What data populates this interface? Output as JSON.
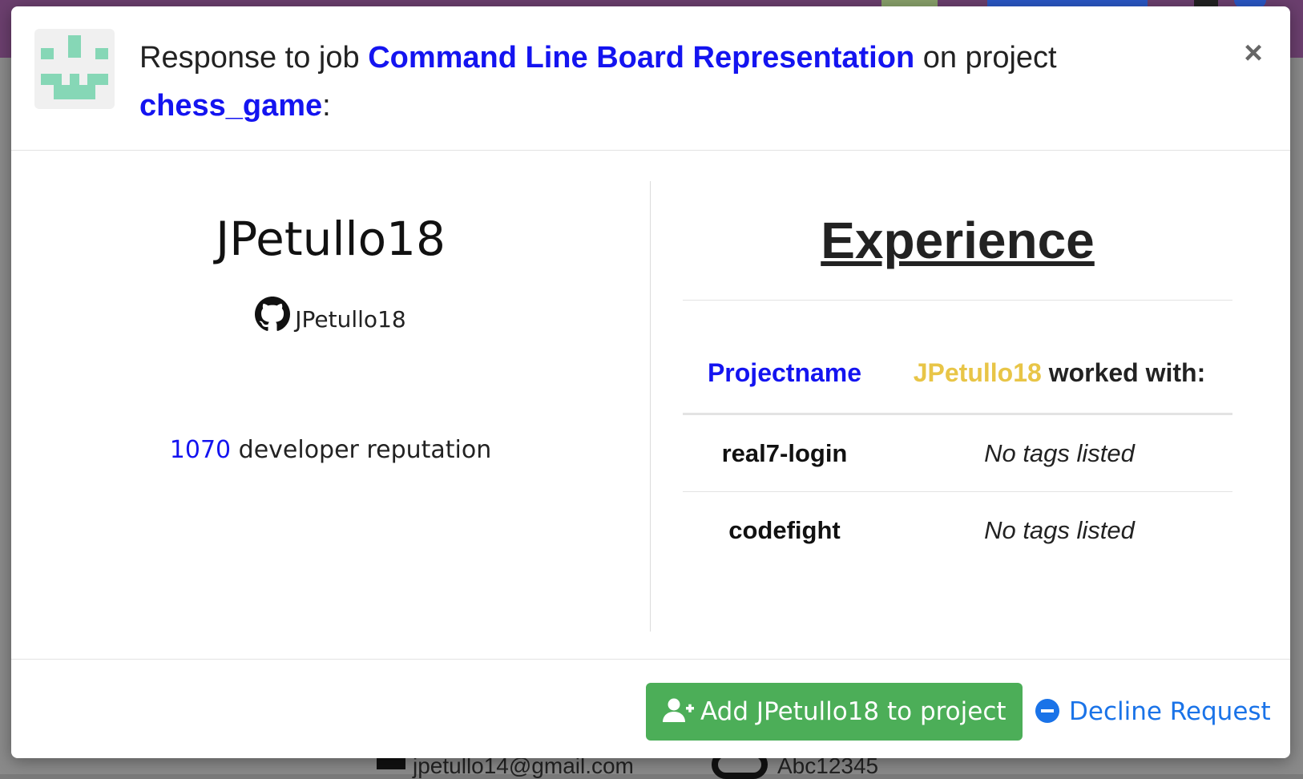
{
  "header": {
    "prefix": "Response to job ",
    "job_name": "Command Line Board Representation",
    "middle": " on project",
    "project_name": "chess_game",
    "suffix": ":",
    "close_label": "×"
  },
  "applicant": {
    "username": "JPetullo18",
    "github_handle": "JPetullo18",
    "reputation_value": "1070",
    "reputation_label": " developer reputation"
  },
  "experience": {
    "title": "Experience",
    "col_project": "Projectname",
    "col_user": "JPetullo18",
    "col_worked": " worked with:",
    "rows": [
      {
        "project": "real7-login",
        "tags": "No tags listed"
      },
      {
        "project": "codefight",
        "tags": "No tags listed"
      }
    ]
  },
  "footer": {
    "add_label": "Add JPetullo18 to project",
    "decline_label": "Decline Request"
  },
  "background": {
    "bottom_text_1": "jpetullo14@gmail.com",
    "bottom_text_2": "Abc12345"
  },
  "colors": {
    "link": "#1414f0",
    "accent_yellow": "#e8c547",
    "success": "#4cae58",
    "decline": "#1a73e8"
  }
}
